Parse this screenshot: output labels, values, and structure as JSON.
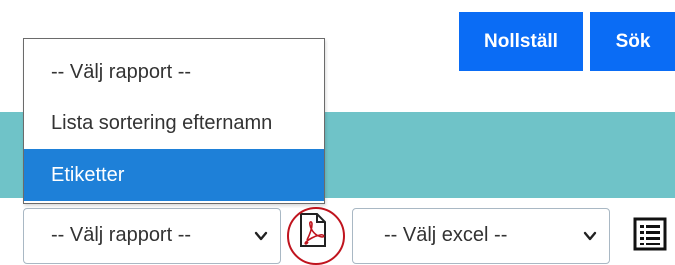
{
  "buttons": {
    "reset_label": "Nollställ",
    "search_label": "Sök"
  },
  "report_dropdown": {
    "options": [
      "-- Välj rapport --",
      "Lista sortering efternamn",
      "Etiketter"
    ],
    "highlighted": "Etiketter",
    "selected_value": "-- Välj rapport --"
  },
  "excel_dropdown": {
    "selected_value": "-- Välj excel --"
  },
  "icons": {
    "pdf": "pdf-icon",
    "list": "list-icon",
    "chevron": "chevron-down-icon"
  },
  "colors": {
    "button_bg": "#0a6cf5",
    "band_bg": "#6fc3c8",
    "highlight_bg": "#1e80d8",
    "circle": "#c0141e"
  }
}
